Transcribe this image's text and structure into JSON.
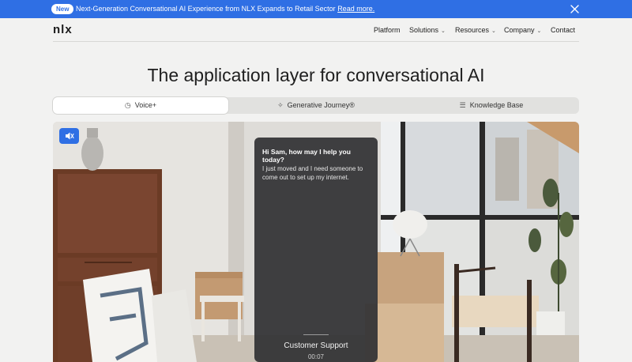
{
  "announcement": {
    "badge": "New",
    "message": "Next-Generation Conversational AI Experience from NLX Expands to Retail Sector",
    "link": "Read more.",
    "close_icon": "close-icon"
  },
  "nav": {
    "logo": "nlx",
    "items": [
      {
        "label": "Platform",
        "dropdown": false
      },
      {
        "label": "Solutions",
        "dropdown": true
      },
      {
        "label": "Resources",
        "dropdown": true
      },
      {
        "label": "Company",
        "dropdown": true
      },
      {
        "label": "Contact",
        "dropdown": false
      }
    ],
    "chevron": "⌄"
  },
  "hero": {
    "title": "The application layer for conversational AI"
  },
  "tabs": [
    {
      "label": "Voice+",
      "icon": "voice-icon",
      "glyph": "◷",
      "active": true
    },
    {
      "label": "Generative Journey®",
      "icon": "sparkle-icon",
      "glyph": "✧",
      "active": false
    },
    {
      "label": "Knowledge Base",
      "icon": "books-icon",
      "glyph": "☰",
      "active": false
    }
  ],
  "media": {
    "sound_icon": "mute-icon",
    "chat": {
      "prompt": "Hi Sam, how may I help you today?",
      "reply": "I just moved and I need someone to come out to set up my internet.",
      "label": "Customer Support",
      "time": "00:07"
    }
  },
  "colors": {
    "accent": "#2f6fe4",
    "background": "#f2f2f1",
    "chat_panel": "#323234"
  }
}
